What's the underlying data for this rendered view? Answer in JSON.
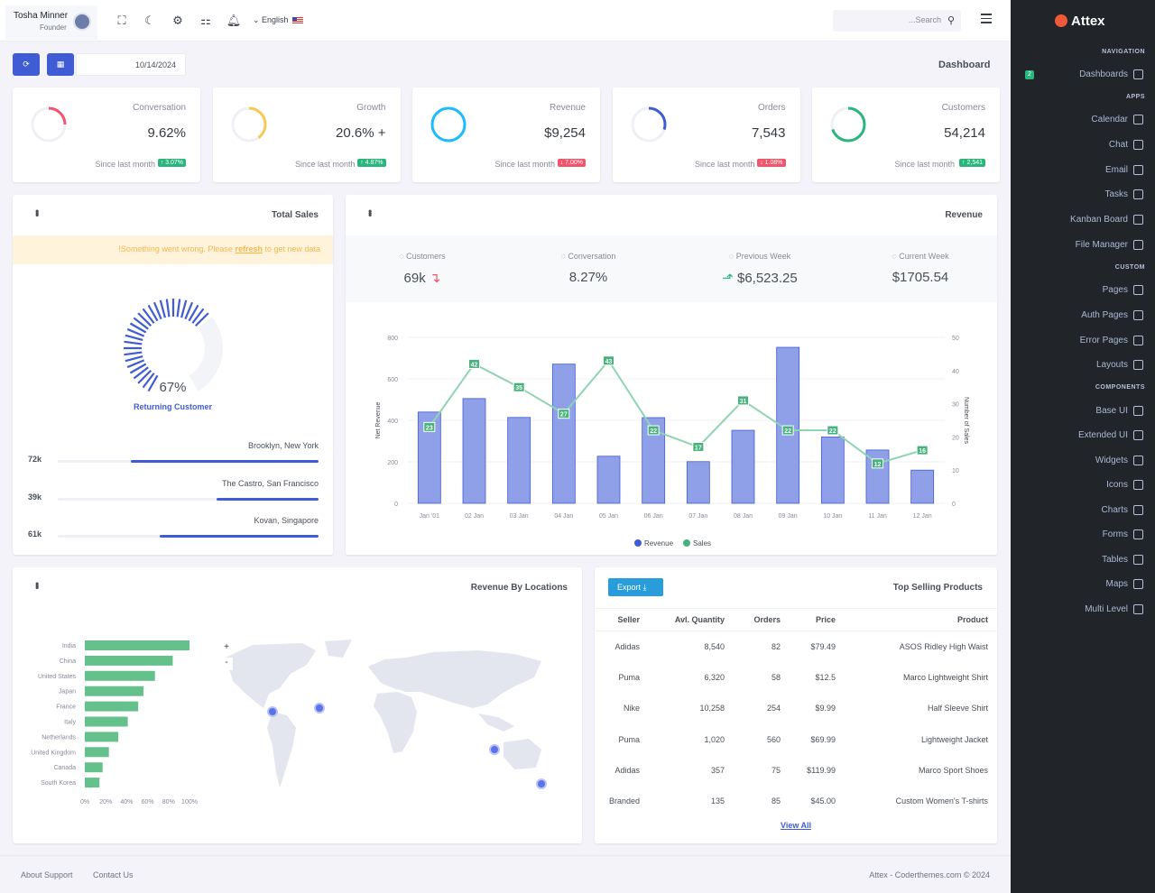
{
  "header": {
    "user_name": "Tosha Minner",
    "user_role": "Founder",
    "language": "English",
    "search_placeholder": "...Search"
  },
  "sidebar": {
    "brand": "Attex",
    "badge": "2",
    "sections": {
      "navigation": "NAVIGATION",
      "apps": "APPS",
      "custom": "CUSTOM",
      "components": "COMPONENTS"
    },
    "items": [
      "Dashboards",
      "Calendar",
      "Chat",
      "Email",
      "Tasks",
      "Kanban Board",
      "File Manager",
      "Pages",
      "Auth Pages",
      "Error Pages",
      "Layouts",
      "Base UI",
      "Extended UI",
      "Widgets",
      "Icons",
      "Charts",
      "Forms",
      "Tables",
      "Maps",
      "Multi Level"
    ]
  },
  "toolbar": {
    "date": "10/14/2024",
    "page_title": "Dashboard"
  },
  "stats": [
    {
      "title": "Conversation",
      "value": "9.62%",
      "since": "Since last month",
      "change": "↑ 3.07%",
      "change_color": "#2ab57d",
      "color": "#f1556c",
      "progress": 0.25
    },
    {
      "title": "Growth",
      "value": "20.6% +",
      "since": "Since last month",
      "change": "↑ 4.87%",
      "change_color": "#2ab57d",
      "color": "#f9c851",
      "progress": 0.4
    },
    {
      "title": "Revenue",
      "value": "$9,254",
      "since": "Since last month",
      "change": "↓ 7.00%",
      "change_color": "#f1556c",
      "color": "#1abcfe",
      "progress": 1
    },
    {
      "title": "Orders",
      "value": "7,543",
      "since": "Since last month",
      "change": "↓ 1.08%",
      "change_color": "#f1556c",
      "color": "#405cd4",
      "progress": 0.3
    },
    {
      "title": "Customers",
      "value": "54,214",
      "since": "Since last month",
      "change": "↑ 2,541",
      "change_color": "#2ab57d",
      "color": "#2ab57d",
      "progress": 0.7
    }
  ],
  "total_sales": {
    "title": "Total Sales",
    "alert_pre": "!Something went wrong. Please ",
    "alert_link": "refresh",
    "alert_post": " to get new data",
    "gauge_value": "67%",
    "gauge_label": "Returning Customer",
    "gauge_fraction": 0.67,
    "locations": [
      {
        "name": "Brooklyn, New York",
        "value": "72k",
        "fraction": 0.72
      },
      {
        "name": "The Castro, San Francisco",
        "value": "39k",
        "fraction": 0.39
      },
      {
        "name": "Kovan, Singapore",
        "value": "61k",
        "fraction": 0.61
      }
    ]
  },
  "revenue": {
    "title": "Revenue",
    "stats": [
      {
        "label": "Customers",
        "value": "69k"
      },
      {
        "label": "Conversation",
        "value": "8.27%"
      },
      {
        "label": "Previous Week",
        "value": "$6,523.25"
      },
      {
        "label": "Current Week",
        "value": "$1705.54"
      }
    ]
  },
  "chart_data": [
    {
      "type": "bar",
      "categories": [
        "Jan '01",
        "02 Jan",
        "03 Jan",
        "04 Jan",
        "05 Jan",
        "06 Jan",
        "07 Jan",
        "08 Jan",
        "09 Jan",
        "10 Jan",
        "11 Jan",
        "12 Jan"
      ],
      "series": [
        {
          "name": "Revenue",
          "type": "bar",
          "values": [
            440,
            505,
            414,
            671,
            227,
            413,
            201,
            352,
            752,
            320,
            257,
            160
          ],
          "color": "#8fa0e8"
        },
        {
          "name": "Sales",
          "type": "line",
          "values": [
            23,
            42,
            35,
            27,
            43,
            22,
            17,
            31,
            22,
            22,
            12,
            16
          ],
          "color": "#8fd4b2",
          "label_color": "#45b37b"
        }
      ],
      "ylabel": "Net Revenue",
      "y2label": "Number of Sales",
      "ylim": [
        0,
        800
      ],
      "y2lim": [
        0,
        50
      ],
      "yticks": [
        0,
        200,
        400,
        600,
        800
      ],
      "y2ticks": [
        0,
        10,
        20,
        30,
        40,
        50
      ]
    },
    {
      "type": "bar",
      "orientation": "horizontal",
      "title": "Revenue By Locations",
      "categories": [
        "India",
        "China",
        "United States",
        "Japan",
        "France",
        "Italy",
        "Netherlands",
        "United Kingdom",
        "Canada",
        "South Korea"
      ],
      "values": [
        100,
        84,
        67,
        56,
        51,
        41,
        32,
        23,
        17,
        14
      ],
      "xticks": [
        "0%",
        "20%",
        "40%",
        "60%",
        "80%",
        "100%"
      ],
      "color": "#65c18c"
    }
  ],
  "map": {
    "zoom_in": "+",
    "zoom_out": "-"
  },
  "products": {
    "title": "Top Selling Products",
    "export": "Export ⤓",
    "columns": [
      "Seller",
      "Avl. Quantity",
      "Orders",
      "Price",
      "Product"
    ],
    "rows": [
      [
        "Adidas",
        "8,540",
        "82",
        "$79.49",
        "ASOS Ridley High Waist"
      ],
      [
        "Puma",
        "6,320",
        "58",
        "$12.5",
        "Marco Lightweight Shirt"
      ],
      [
        "Nike",
        "10,258",
        "254",
        "$9.99",
        "Half Sleeve Shirt"
      ],
      [
        "Puma",
        "1,020",
        "560",
        "$69.99",
        "Lightweight Jacket"
      ],
      [
        "Adidas",
        "357",
        "75",
        "$119.99",
        "Marco Sport Shoes"
      ],
      [
        "Branded",
        "135",
        "85",
        "$45.00",
        "Custom Women's T-shirts"
      ]
    ],
    "view_all": "View All"
  },
  "footer": {
    "about": "About Support",
    "contact": "Contact Us",
    "copyright": "Attex - Coderthemes.com © 2024"
  }
}
